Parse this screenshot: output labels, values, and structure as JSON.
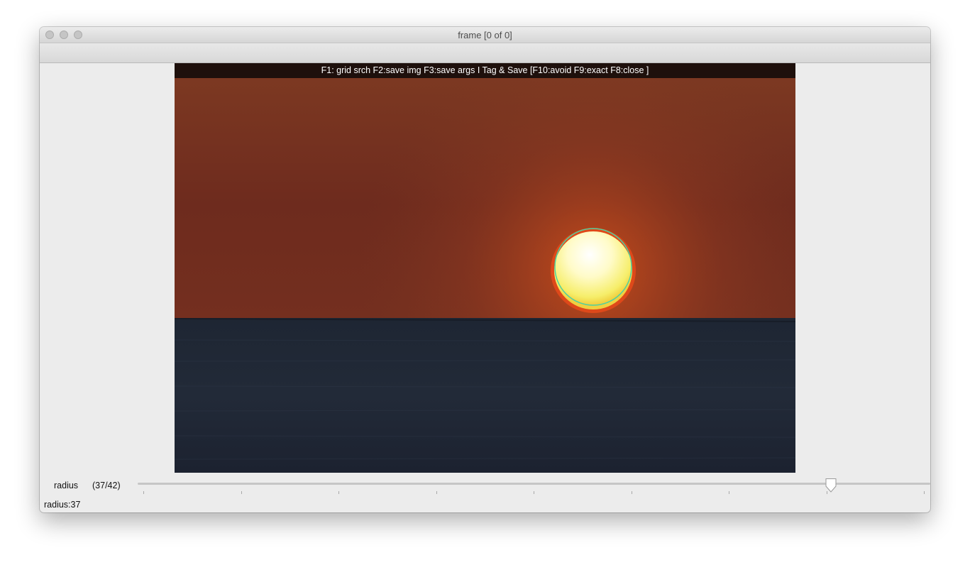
{
  "window": {
    "title": "frame [0 of 0]"
  },
  "viewer": {
    "overlay_text": "F1: grid srch F2:save img F3:save args I Tag & Save [F10:avoid F9:exact F8:close ]"
  },
  "trackbar": {
    "label": "radius",
    "count": "(37/42)",
    "value": 37,
    "max": 42,
    "tick_count": 9
  },
  "status": {
    "text": "radius:37"
  },
  "colors": {
    "detected_circle": "#4fd0a0",
    "sky": "#7a3320",
    "sun": "#fff8a8",
    "sea": "#1f2634"
  }
}
